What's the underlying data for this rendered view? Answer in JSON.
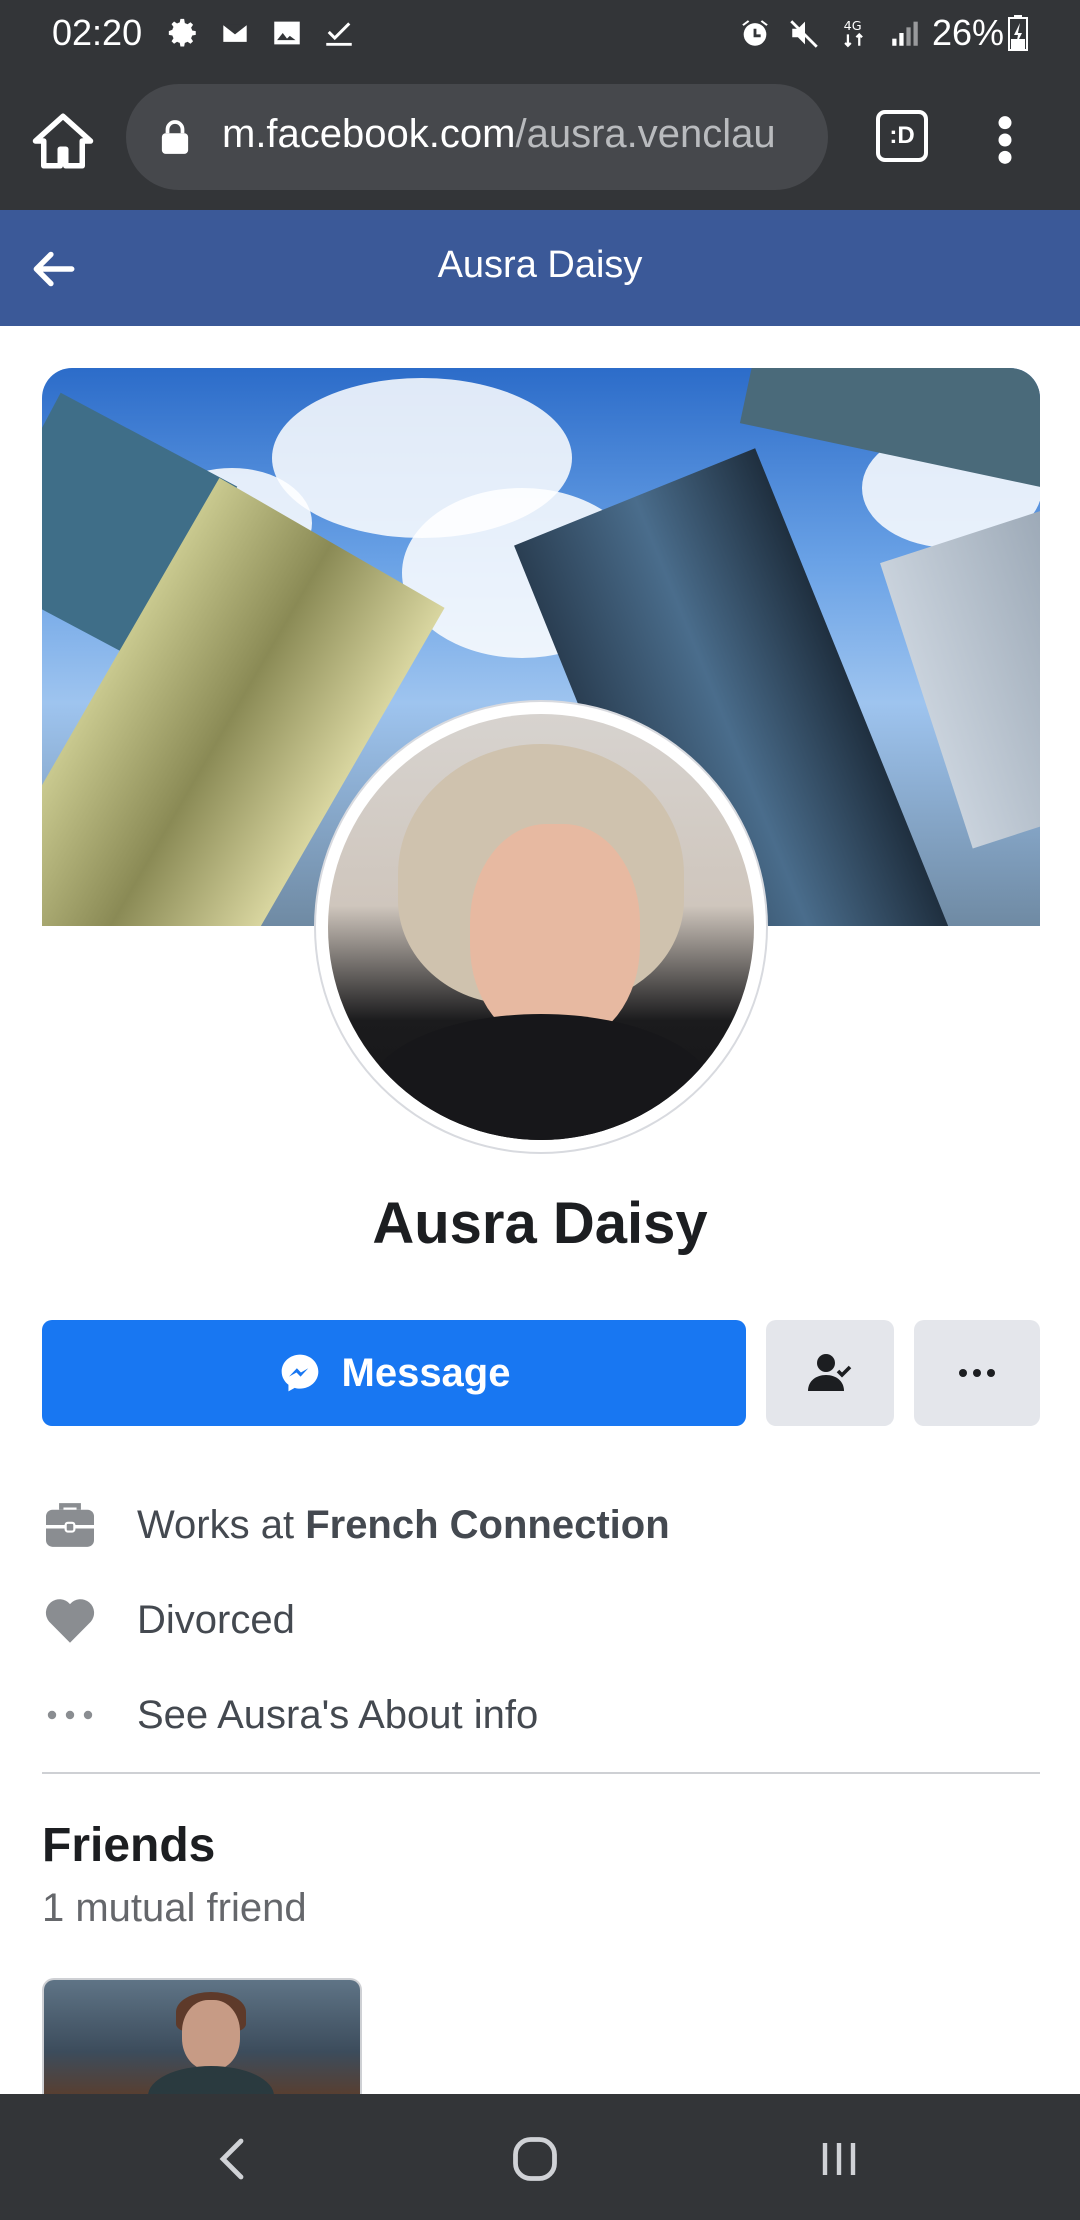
{
  "status_bar": {
    "time": "02:20",
    "left_icons": [
      "settings-icon",
      "gmail-icon",
      "gallery-icon",
      "check-icon"
    ],
    "right_icons": [
      "alarm-icon",
      "mute-icon",
      "4g-data-icon",
      "signal-icon"
    ],
    "battery": "26%"
  },
  "browser": {
    "url_domain": "m.facebook.com",
    "url_path": "/ausra.venclau",
    "tab_badge": ":D"
  },
  "header": {
    "title": "Ausra Daisy"
  },
  "profile": {
    "name": "Ausra Daisy",
    "message_label": "Message"
  },
  "intro": {
    "work_prefix": "Works at ",
    "work_place": "French Connection",
    "relationship": "Divorced",
    "about_link": "See Ausra's About info"
  },
  "friends": {
    "title": "Friends",
    "mutual": "1 mutual friend"
  },
  "colors": {
    "fb_blue": "#3b5998",
    "message_blue": "#1877f2",
    "chrome_dark": "#333538",
    "button_grey": "#e4e6eb"
  }
}
